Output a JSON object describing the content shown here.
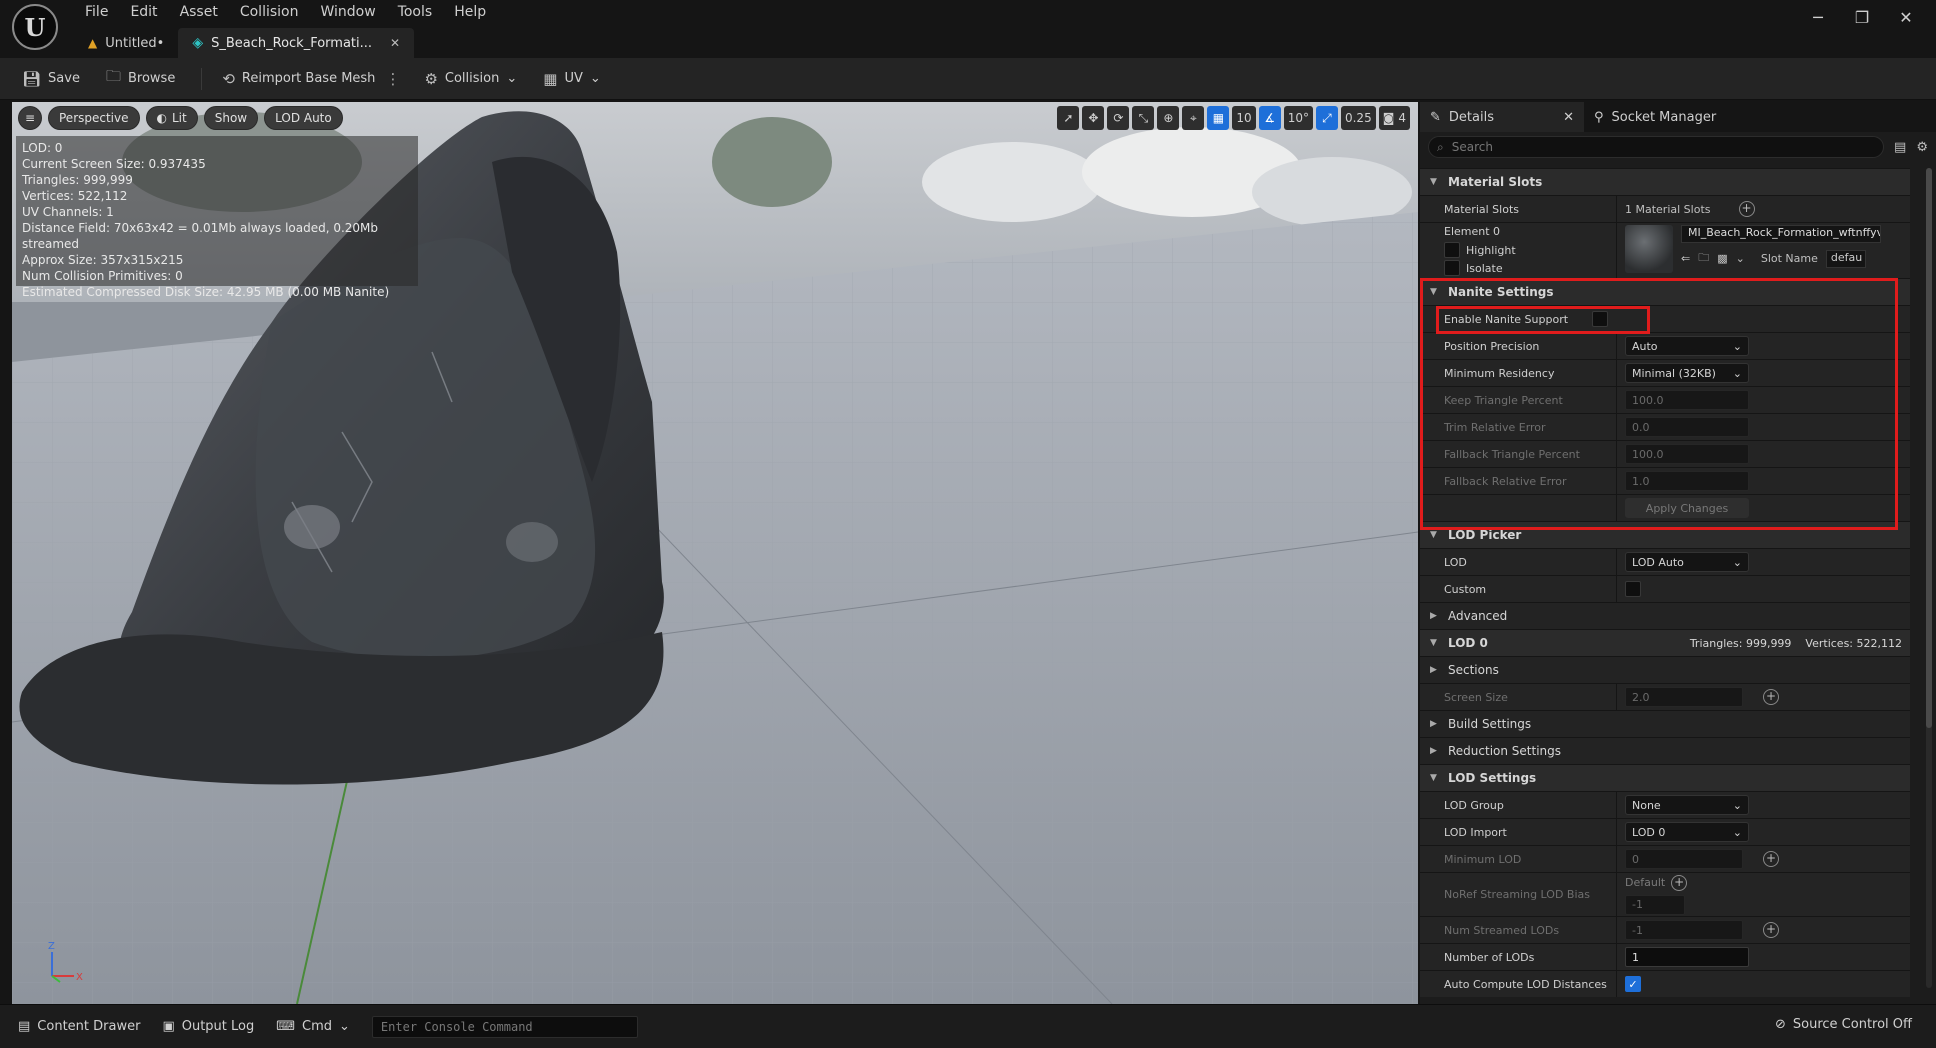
{
  "menu": [
    "File",
    "Edit",
    "Asset",
    "Collision",
    "Window",
    "Tools",
    "Help"
  ],
  "tabs": [
    {
      "label": "Untitled•",
      "active": false
    },
    {
      "label": "S_Beach_Rock_Formati...",
      "active": true
    }
  ],
  "window_controls": {
    "minimize": "─",
    "restore": "❐",
    "close": "✕"
  },
  "toolbar": {
    "save": "Save",
    "browse": "Browse",
    "reimport": "Reimport Base Mesh",
    "collision": "Collision",
    "uv": "UV"
  },
  "viewport": {
    "menu_glyph": "≡",
    "perspective": "Perspective",
    "lit": "Lit",
    "show": "Show",
    "lod": "LOD Auto",
    "grid_snap": "10",
    "rotation_snap": "10°",
    "scale_snap": "0.25",
    "camera_speed": "4",
    "axis_z": "Z",
    "axis_x": "X",
    "stats": [
      "LOD:  0",
      "Current Screen Size:  0.937435",
      "Triangles:  999,999",
      "Vertices:  522,112",
      "UV Channels:  1",
      "Distance Field:  70x63x42 = 0.01Mb always loaded, 0.20Mb streamed",
      "Approx Size: 357x315x215",
      "Num Collision Primitives:  0",
      "Estimated Compressed Disk Size: 42.95 MB (0.00 MB Nanite)"
    ]
  },
  "details": {
    "tab_details": "Details",
    "tab_socket": "Socket Manager",
    "search_placeholder": "Search",
    "material_slots": {
      "header": "Material Slots",
      "label": "Material Slots",
      "value": "1 Material Slots",
      "element": "Element 0",
      "highlight": "Highlight",
      "isolate": "Isolate",
      "material_name": "MI_Beach_Rock_Formation_wftnffyva",
      "slot_name_label": "Slot Name",
      "slot_name_value": "defau"
    },
    "nanite": {
      "header": "Nanite Settings",
      "enable": "Enable Nanite Support",
      "position_precision": {
        "label": "Position Precision",
        "value": "Auto"
      },
      "min_residency": {
        "label": "Minimum Residency",
        "value": "Minimal (32KB)"
      },
      "keep_triangle": {
        "label": "Keep Triangle Percent",
        "value": "100.0"
      },
      "trim_error": {
        "label": "Trim Relative Error",
        "value": "0.0"
      },
      "fallback_triangle": {
        "label": "Fallback Triangle Percent",
        "value": "100.0"
      },
      "fallback_error": {
        "label": "Fallback Relative Error",
        "value": "1.0"
      },
      "apply": "Apply Changes"
    },
    "lod_picker": {
      "header": "LOD Picker",
      "lod": {
        "label": "LOD",
        "value": "LOD Auto"
      },
      "custom": "Custom",
      "advanced": "Advanced"
    },
    "lod0": {
      "header": "LOD 0",
      "summary": "Triangles: 999,999    Vertices: 522,112",
      "sections": "Sections",
      "screen_size": {
        "label": "Screen Size",
        "value": "2.0"
      },
      "build": "Build Settings",
      "reduction": "Reduction Settings"
    },
    "lod_settings": {
      "header": "LOD Settings",
      "group": {
        "label": "LOD Group",
        "value": "None"
      },
      "import": {
        "label": "LOD Import",
        "value": "LOD 0"
      },
      "min_lod": {
        "label": "Minimum LOD",
        "value": "0"
      },
      "noref": {
        "label": "NoRef Streaming LOD Bias",
        "default": "Default",
        "value": "-1"
      },
      "streamed": {
        "label": "Num Streamed LODs",
        "value": "-1"
      },
      "count": {
        "label": "Number of LODs",
        "value": "1"
      },
      "auto": "Auto Compute LOD Distances"
    }
  },
  "statusbar": {
    "content_drawer": "Content Drawer",
    "output_log": "Output Log",
    "cmd": "Cmd",
    "console_placeholder": "Enter Console Command",
    "source_control": "Source Control Off"
  },
  "colors": {
    "accent": "#1e6fd9",
    "highlight": "#e01c1c",
    "panel": "#242424"
  }
}
